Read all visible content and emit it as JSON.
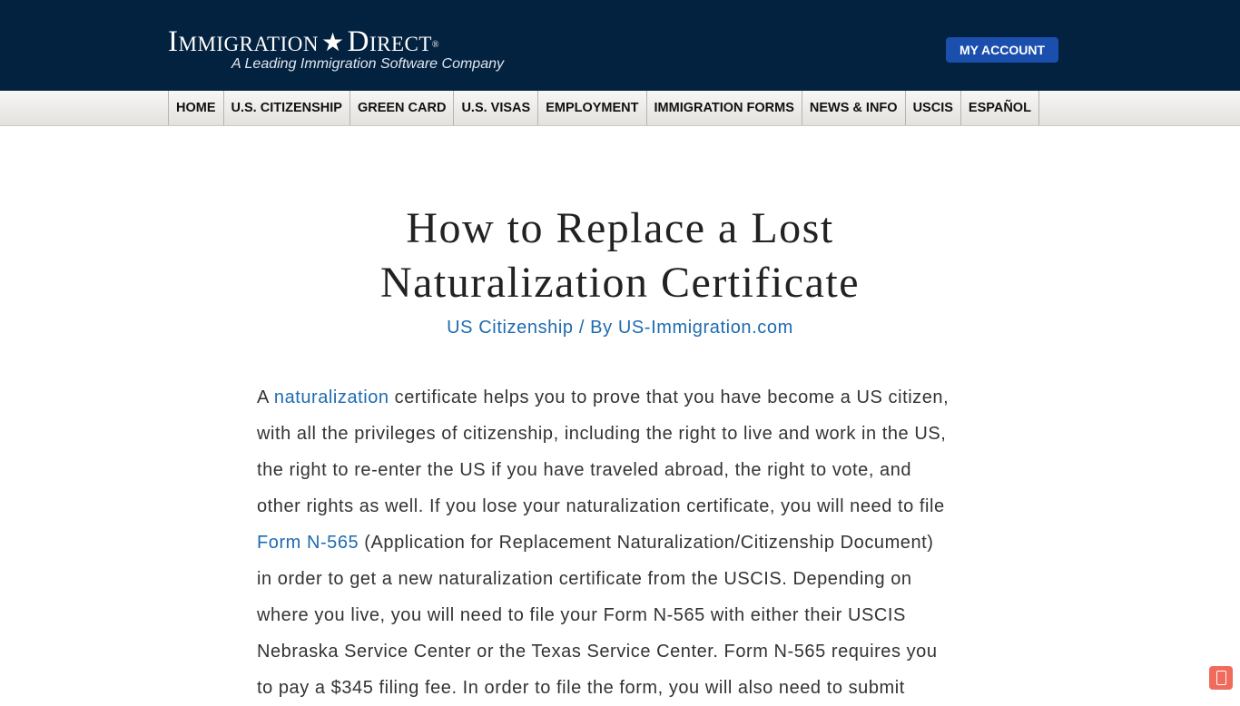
{
  "header": {
    "logo_left": "Immigration",
    "logo_star": "★",
    "logo_right": "Direct",
    "logo_reg": "®",
    "logo_tagline": "A Leading Immigration Software Company",
    "account_button": "MY ACCOUNT"
  },
  "nav": {
    "items": [
      "HOME",
      "U.S. CITIZENSHIP",
      "GREEN CARD",
      "U.S. VISAS",
      "EMPLOYMENT",
      "IMMIGRATION FORMS",
      "NEWS & INFO",
      "USCIS",
      "ESPAÑOL"
    ]
  },
  "article": {
    "title_line1": "How to Replace a Lost",
    "title_line2": "Naturalization Certificate",
    "category": "US Citizenship",
    "separator": " / By ",
    "author": "US-Immigration.com",
    "p1": {
      "l1_a": "A ",
      "l1_link": "naturalization",
      "l1_b": " certificate helps you to prove that you have become a US citizen,",
      "l2": "with all the privileges of citizenship, including the right to live and work in the US,",
      "l3": "the right to re-enter the US if you have traveled abroad, the right to vote, and",
      "l4": "other rights as well. If you lose your naturalization certificate, you will need to file",
      "l5_link": "Form N-565",
      "l5_b": " (Application for Replacement Naturalization/Citizenship Document)",
      "l6": "in order to get a new naturalization certificate from the USCIS. Depending on",
      "l7": "where you live, you will need to file your Form N-565 with either their USCIS",
      "l8": "Nebraska Service Center or the Texas Service Center. Form N-565 requires you",
      "l9": "to pay a $345 filing fee. In order to file the form, you will also need to submit"
    }
  },
  "colors": {
    "header_bg": "#03223f",
    "account_button": "#1a4fad",
    "link": "#1e6bb0",
    "floating_icon": "#f06b5d"
  },
  "icons": {
    "floating": "mobile-phone-icon"
  }
}
